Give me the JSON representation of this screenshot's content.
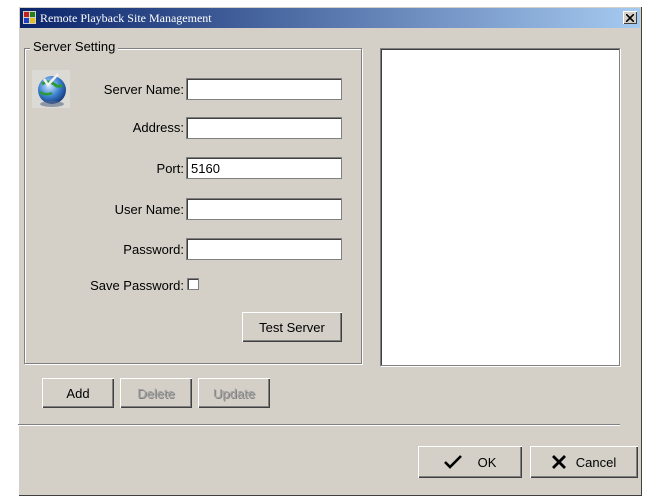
{
  "window": {
    "title": "Remote Playback Site Management",
    "title_bar_color": "#0a246a"
  },
  "server_setting": {
    "legend": "Server Setting",
    "server_name_label": "Server Name:",
    "server_name_value": "",
    "address_label": "Address:",
    "address_value": "",
    "port_label": "Port:",
    "port_value": "5160",
    "user_name_label": "User Name:",
    "user_name_value": "",
    "password_label": "Password:",
    "password_value": "",
    "save_password_label": "Save Password:",
    "save_password_checked": false,
    "test_server_label": "Test Server",
    "icon": "globe-check-icon"
  },
  "actions": {
    "add_label": "Add",
    "delete_label": "Delete",
    "update_label": "Update"
  },
  "dialog": {
    "ok_label": "OK",
    "cancel_label": "Cancel"
  }
}
